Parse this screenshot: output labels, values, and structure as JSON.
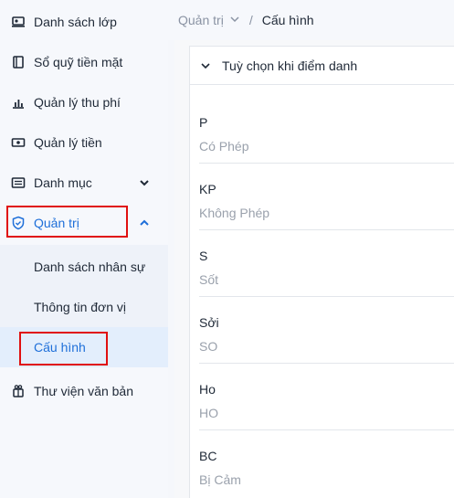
{
  "sidebar": {
    "items": [
      {
        "label": "Danh sách lớp",
        "icon": "class-list-icon"
      },
      {
        "label": "Sổ quỹ tiền mặt",
        "icon": "cash-book-icon"
      },
      {
        "label": "Quản lý thu phí",
        "icon": "fee-chart-icon"
      },
      {
        "label": "Quản lý tiền",
        "icon": "money-icon"
      },
      {
        "label": "Danh mục",
        "icon": "catalog-icon"
      },
      {
        "label": "Quản trị",
        "icon": "shield-icon"
      },
      {
        "label": "Thư viện văn bản",
        "icon": "library-icon"
      }
    ],
    "submenu": [
      {
        "label": "Danh sách nhân sự"
      },
      {
        "label": "Thông tin đơn vị"
      },
      {
        "label": "Cấu hình"
      }
    ]
  },
  "breadcrumb": {
    "parent": "Quản trị",
    "separator": "/",
    "current": "Cấu hình"
  },
  "panel": {
    "title": "Tuỳ chọn khi điểm danh",
    "options": [
      {
        "code": "P",
        "name": "Có Phép"
      },
      {
        "code": "KP",
        "name": "Không Phép"
      },
      {
        "code": "S",
        "name": "Sốt"
      },
      {
        "code": "Sởi",
        "name": "SO"
      },
      {
        "code": "Ho",
        "name": "HO"
      },
      {
        "code": "BC",
        "name": "Bị Cảm"
      }
    ]
  },
  "colors": {
    "accent": "#1e6fd9",
    "highlight": "#e01010",
    "muted": "#9aa1ac"
  }
}
